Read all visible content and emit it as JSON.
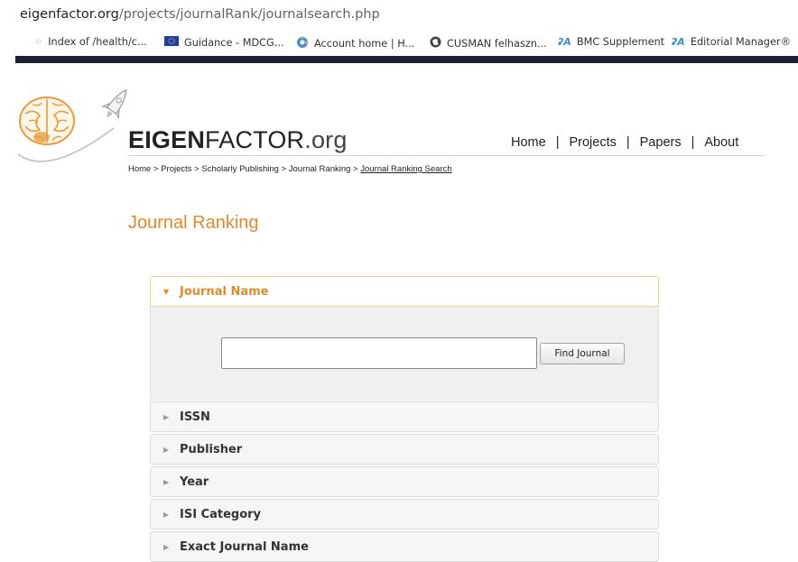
{
  "browser": {
    "url_host": "eigenfactor.org",
    "url_path": "/projects/journalRank/journalsearch.php",
    "bookmarks": [
      {
        "label": "Index of /health/c...",
        "icon": "sparkle-icon"
      },
      {
        "label": "Guidance - MDCG...",
        "icon": "eu-flag-icon"
      },
      {
        "label": "Account home | H...",
        "icon": "gear-flower-icon"
      },
      {
        "label": "CUSMAN felhaszn...",
        "icon": "globe-icon"
      },
      {
        "label": "BMC Supplement",
        "icon": "editorial-logo-icon"
      },
      {
        "label": "Editorial Manager®",
        "icon": "editorial-logo-icon"
      }
    ]
  },
  "site": {
    "brand_bold": "EIGEN",
    "brand_rest": "FACTOR",
    "brand_tld": ".org",
    "nav": [
      "Home",
      "Projects",
      "Papers",
      "About"
    ],
    "nav_sep": "|"
  },
  "breadcrumb": {
    "items": [
      "Home",
      "Projects",
      "Scholarly Publishing",
      "Journal Ranking"
    ],
    "sep": ">",
    "current": "Journal Ranking Search"
  },
  "page": {
    "title": "Journal Ranking"
  },
  "search": {
    "active_panel": "Journal Name",
    "input_value": "",
    "button_label": "Find Journal",
    "panels": [
      "ISSN",
      "Publisher",
      "Year",
      "ISI Category",
      "Exact Journal Name"
    ]
  },
  "colors": {
    "accent": "#e08a2c",
    "header_bar": "#1b2133",
    "panel_bg": "#f6f6f6"
  }
}
